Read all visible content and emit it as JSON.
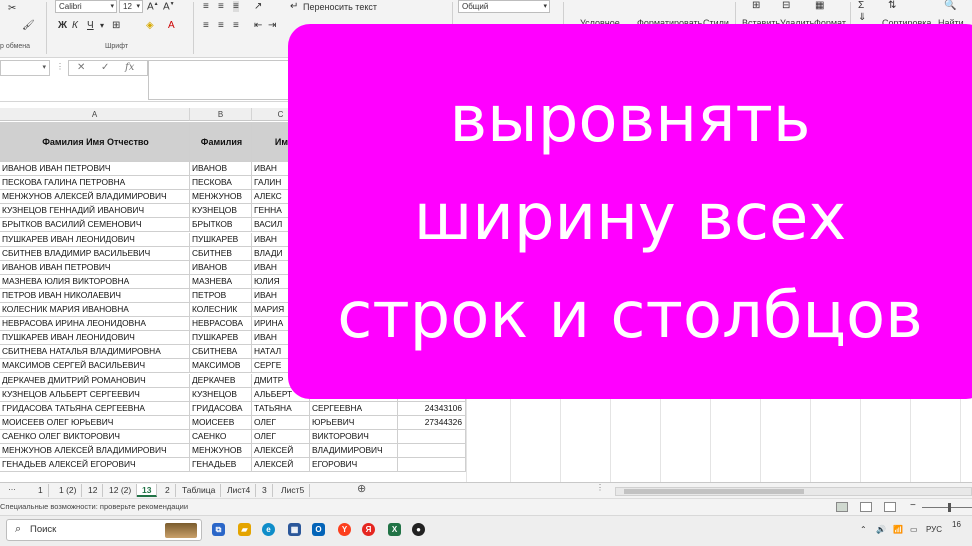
{
  "ribbon": {
    "font_name": "Calibri",
    "font_size": "12",
    "wrap_text": "Переносить текст",
    "number_format": "Общий",
    "group_clipboard": "р обмена",
    "group_font": "Шрифт",
    "cmd_conditional": "Условное",
    "cmd_format_as": "Форматировать",
    "cmd_styles": "Стили",
    "cmd_insert": "Вставить",
    "cmd_delete": "Удалить",
    "cmd_format": "Формат",
    "cmd_sort": "Сортировка",
    "cmd_find": "Найти"
  },
  "formula_bar": {
    "fx": "fx"
  },
  "columns": [
    "A",
    "B",
    "C"
  ],
  "header_row": [
    "Фамилия  Имя Отчество",
    "Фамилия",
    "Им"
  ],
  "rows": [
    [
      "ИВАНОВ ИВАН ПЕТРОВИЧ",
      "ИВАНОВ",
      "ИВАН",
      "",
      ""
    ],
    [
      "ПЕСКОВА ГАЛИНА ПЕТРОВНА",
      "ПЕСКОВА",
      "ГАЛИН",
      "",
      ""
    ],
    [
      "МЕНЖУНОВ АЛЕКСЕЙ ВЛАДИМИРОВИЧ",
      "МЕНЖУНОВ",
      "АЛЕКС",
      "",
      ""
    ],
    [
      "КУЗНЕЦОВ ГЕННАДИЙ ИВАНОВИЧ",
      "КУЗНЕЦОВ",
      "ГЕННА",
      "",
      ""
    ],
    [
      "БРЫТКОВ ВАСИЛИЙ СЕМЕНОВИЧ",
      "БРЫТКОВ",
      "ВАСИЛ",
      "",
      ""
    ],
    [
      "ПУШКАРЕВ ИВАН ЛЕОНИДОВИЧ",
      "ПУШКАРЕВ",
      "ИВАН",
      "",
      ""
    ],
    [
      "СБИТНЕВ ВЛАДИМИР ВАСИЛЬЕВИЧ",
      "СБИТНЕВ",
      "ВЛАДИ",
      "",
      ""
    ],
    [
      "ИВАНОВ ИВАН ПЕТРОВИЧ",
      "ИВАНОВ",
      "ИВАН",
      "",
      ""
    ],
    [
      "МАЗНЕВА ЮЛИЯ ВИКТОРОВНА",
      "МАЗНЕВА",
      "ЮЛИЯ",
      "",
      ""
    ],
    [
      "ПЕТРОВ ИВАН НИКОЛАЕВИЧ",
      "ПЕТРОВ",
      "ИВАН",
      "",
      ""
    ],
    [
      "КОЛЕСНИК МАРИЯ ИВАНОВНА",
      "КОЛЕСНИК",
      "МАРИЯ",
      "",
      ""
    ],
    [
      "НЕВРАСОВА ИРИНА ЛЕОНИДОВНА",
      "НЕВРАСОВА",
      "ИРИНА",
      "",
      ""
    ],
    [
      "ПУШКАРЕВ ИВАН ЛЕОНИДОВИЧ",
      "ПУШКАРЕВ",
      "ИВАН",
      "",
      ""
    ],
    [
      "СБИТНЕВА НАТАЛЬЯ ВЛАДИМИРОВНА",
      "СБИТНЕВА",
      "НАТАЛ",
      "",
      ""
    ],
    [
      "МАКСИМОВ СЕРГЕЙ ВАСИЛЬЕВИЧ",
      "МАКСИМОВ",
      "СЕРГЕ",
      "",
      ""
    ],
    [
      "ДЕРКАЧЕВ ДМИТРИЙ РОМАНОВИЧ",
      "ДЕРКАЧЕВ",
      "ДМИТР",
      "",
      ""
    ],
    [
      "КУЗНЕЦОВ АЛЬБЕРТ СЕРГЕЕВИЧ",
      "КУЗНЕЦОВ",
      "АЛЬБЕРТ",
      "",
      ""
    ],
    [
      "ГРИДАСОВА ТАТЬЯНА СЕРГЕЕВНА",
      "ГРИДАСОВА",
      "ТАТЬЯНА",
      "СЕРГЕЕВНА",
      "24343106"
    ],
    [
      "МОИСЕЕВ ОЛЕГ ЮРЬЕВИЧ",
      "МОИСЕЕВ",
      "ОЛЕГ",
      "ЮРЬЕВИЧ",
      "27344326"
    ],
    [
      "САЕНКО ОЛЕГ ВИКТОРОВИЧ",
      "САЕНКО",
      "ОЛЕГ",
      "ВИКТОРОВИЧ",
      ""
    ],
    [
      "МЕНЖУНОВ АЛЕКСЕЙ ВЛАДИМИРОВИЧ",
      "МЕНЖУНОВ",
      "АЛЕКСЕЙ",
      "ВЛАДИМИРОВИЧ",
      ""
    ],
    [
      "ГЕНАДЬЕВ АЛЕКСЕЙ ЕГОРОВИЧ",
      "ГЕНАДЬЕВ",
      "АЛЕКСЕЙ",
      "ЕГОРОВИЧ",
      ""
    ]
  ],
  "overlay": {
    "line1": "выровнять",
    "line2": "ширину всех",
    "line3": "строк и столбцов",
    "color": "#ff00ff"
  },
  "sheet_tabs": [
    "1",
    "1 (2)",
    "12",
    "12 (2)",
    "13",
    "2",
    "Таблица",
    "Лист4",
    "3",
    "Лист5"
  ],
  "active_tab": "13",
  "status": {
    "accessibility": "Специальные возможности: проверьте рекомендации"
  },
  "taskbar": {
    "search_label": "Поиск",
    "lang": "РУС",
    "time": "16"
  }
}
